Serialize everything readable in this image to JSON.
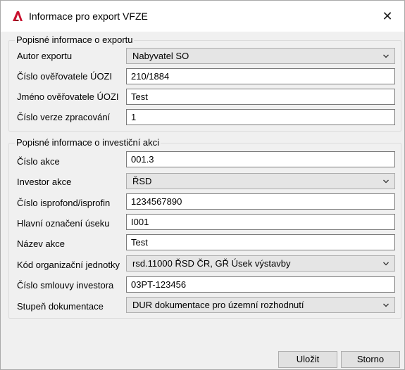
{
  "window": {
    "title": "Informace pro export VFZE",
    "close_glyph": "✕",
    "icon": "autocad-a-icon",
    "accent": "#c8102e"
  },
  "export_group": {
    "legend": "Popisné informace o exportu",
    "fields": {
      "author_label": "Autor exportu",
      "author_value": "Nabyvatel SO",
      "verifier_number_label": "Číslo ověřovatele ÚOZI",
      "verifier_number_value": "210/1884",
      "verifier_name_label": "Jméno ověřovatele ÚOZI",
      "verifier_name_value": "Test",
      "version_label": "Číslo verze zpracování",
      "version_value": "1"
    }
  },
  "investment_group": {
    "legend": "Popisné informace o investiční akci",
    "fields": {
      "action_number_label": "Číslo akce",
      "action_number_value": "001.3",
      "investor_label": "Investor akce",
      "investor_value": "ŘSD",
      "isprofond_label": "Číslo isprofond/isprofin",
      "isprofond_value": "1234567890",
      "segment_label": "Hlavní označení úseku",
      "segment_value": "I001",
      "action_name_label": "Název akce",
      "action_name_value": "Test",
      "org_unit_label": "Kód organizační jednotky",
      "org_unit_value": "rsd.11000 ŘSD ČR, GŘ Úsek výstavby",
      "contract_label": "Číslo smlouvy investora",
      "contract_value": "03PT-123456",
      "doc_stage_label": "Stupeň dokumentace",
      "doc_stage_value": "DUR dokumentace pro územní rozhodnutí"
    }
  },
  "buttons": {
    "save_label": "Uložit",
    "cancel_label": "Storno"
  }
}
